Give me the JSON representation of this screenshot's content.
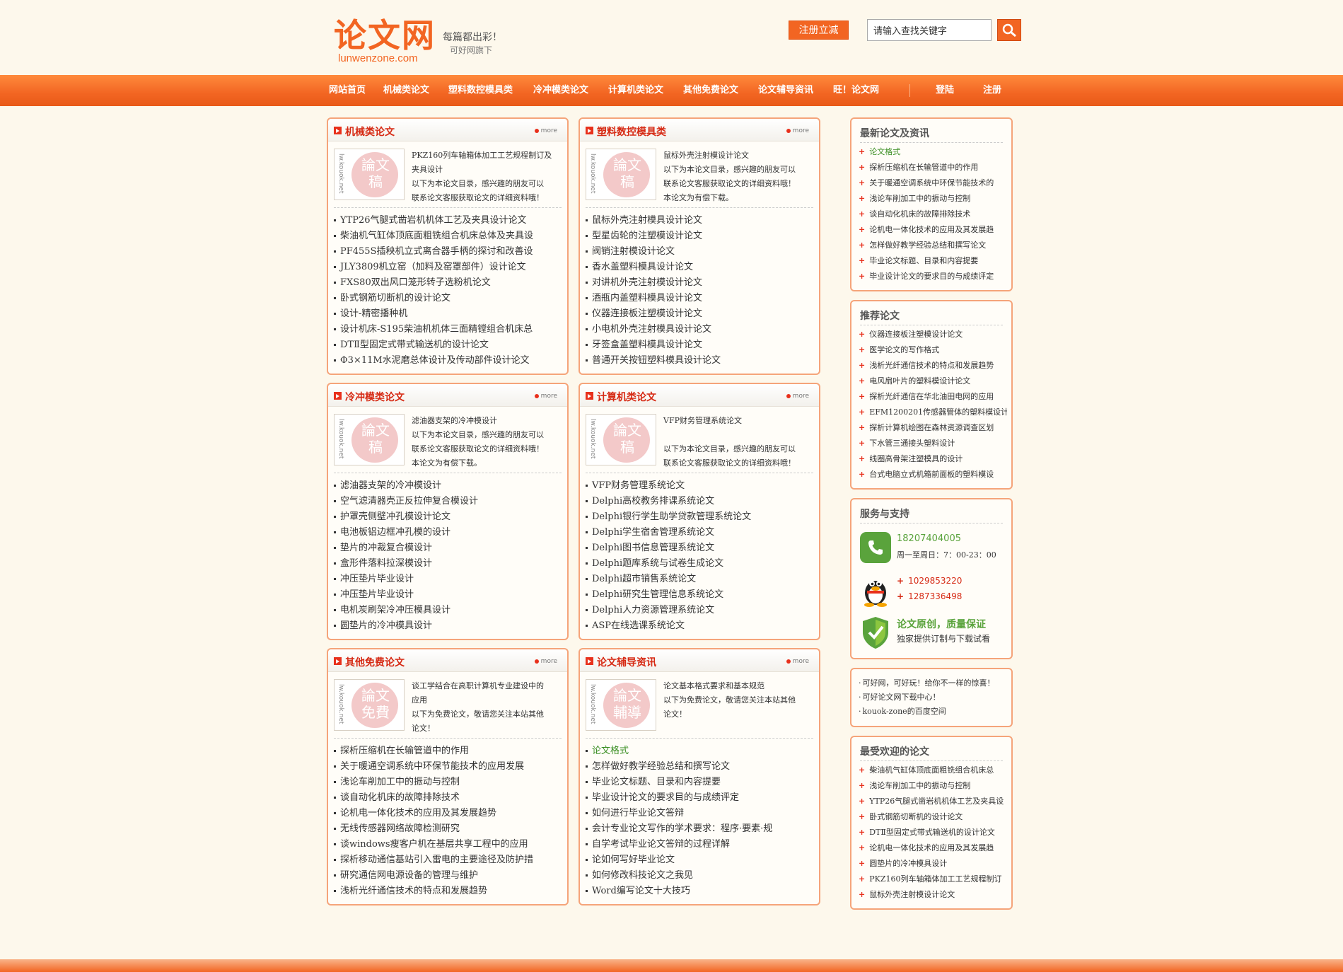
{
  "header": {
    "logo_cn": "论文网",
    "logo_en": "lunwenzone.com",
    "slogan1": "每篇都出彩！",
    "slogan2": "可好网旗下",
    "register_button": "注册立减",
    "search_placeholder": "请输入查找关键字"
  },
  "nav": [
    {
      "label": "网站首页"
    },
    {
      "label": "机械类论文"
    },
    {
      "label": "塑料数控模具类"
    },
    {
      "label": "冷冲模类论文"
    },
    {
      "label": "计算机类论文"
    },
    {
      "label": "其他免费论文"
    },
    {
      "label": "论文辅导资讯"
    },
    {
      "label": "旺！论文网"
    },
    {
      "label": "登陆"
    },
    {
      "label": "注册"
    }
  ],
  "boxes": [
    {
      "title": "机械类论文",
      "more": "more",
      "thumb_v": "lw.kouok.net",
      "thumb_seal": "論文稿",
      "desc": [
        "PKZ160列车轴箱体加工工艺规程制订及",
        "夹具设计",
        "以下为本论文目录，感兴趣的朋友可以",
        "联系论文客服获取论文的详细资料哦！"
      ],
      "items": [
        "YTP26气腿式凿岩机机体工艺及夹具设计论文",
        "柴油机气缸体顶底面粗铣组合机床总体及夹具设",
        "PF455S插秧机立式离合器手柄的探讨和改善设",
        "JLY3809机立窑（加料及窑罩部件）设计论文",
        "FXS80双出风口笼形转子选粉机论文",
        "卧式钢筋切断机的设计论文",
        "设计-精密播种机",
        "设计机床-S195柴油机机体三面精镗组合机床总",
        "DTⅡ型固定式带式输送机的设计论文",
        "Φ3×11M水泥磨总体设计及传动部件设计论文"
      ]
    },
    {
      "title": "塑料数控模具类",
      "more": "more",
      "thumb_v": "lw.kouok.net",
      "thumb_seal": "論文稿",
      "desc": [
        "鼠标外壳注射模设计论文",
        "以下为本论文目录，感兴趣的朋友可以",
        "联系论文客服获取论文的详细资料哦！",
        "本论文为有偿下载。"
      ],
      "items": [
        "鼠标外壳注射模具设计论文",
        "型星齿轮的注塑模设计论文",
        "阀销注射模设计论文",
        "香水盖塑料模具设计论文",
        "对讲机外壳注射模设计论文",
        "酒瓶内盖塑料模具设计论文",
        "仪器连接板注塑模设计论文",
        "小电机外壳注射模具设计论文",
        "牙签盒盖塑料模具设计论文",
        "普通开关按钮塑料模具设计论文"
      ]
    },
    {
      "title": "冷冲模类论文",
      "more": "more",
      "thumb_v": "lw.kouok.net",
      "thumb_seal": "論文稿",
      "desc": [
        "滤油器支架的冷冲模设计",
        "以下为本论文目录，感兴趣的朋友可以",
        "联系论文客服获取论文的详细资料哦！",
        "本论文为有偿下载。"
      ],
      "items": [
        "滤油器支架的冷冲模设计",
        "空气滤清器壳正反拉伸复合模设计",
        "护罩壳侧壁冲孔模设计论文",
        "电池板铝边框冲孔模的设计",
        "垫片的冲裁复合模设计",
        "盒形件落料拉深模设计",
        "冲压垫片毕业设计",
        "冲压垫片毕业设计",
        "电机炭刷架冷冲压模具设计",
        "圆垫片的冷冲模具设计"
      ]
    },
    {
      "title": "计算机类论文",
      "more": "more",
      "thumb_v": "lw.kouok.net",
      "thumb_seal": "論文稿",
      "desc": [
        "VFP财务管理系统论文",
        "",
        "以下为本论文目录，感兴趣的朋友可以",
        "联系论文客服获取论文的详细资料哦！"
      ],
      "items": [
        "VFP财务管理系统论文",
        "Delphi高校教务排课系统论文",
        "Delphi银行学生助学贷款管理系统论文",
        "Delphi学生宿舍管理系统论文",
        "Delphi图书信息管理系统论文",
        "Delphi题库系统与试卷生成论文",
        "Delphi超市销售系统论文",
        "Delphi研究生管理信息系统论文",
        "Delphi人力资源管理系统论文",
        "ASP在线选课系统论文"
      ]
    },
    {
      "title": "其他免费论文",
      "more": "more",
      "thumb_v": "lw.kouok.net",
      "thumb_seal": "論文免費",
      "desc": [
        "谈工学结合在高职计算机专业建设中的",
        "应用",
        "以下为免费论文，敬请您关注本站其他",
        "论文！"
      ],
      "items": [
        "探析压缩机在长输管道中的作用",
        "关于暖通空调系统中环保节能技术的应用发展",
        "浅论车削加工中的振动与控制",
        "谈自动化机床的故障排除技术",
        "论机电一体化技术的应用及其发展趋势",
        "无线传感器网络故障检测研究",
        "谈windows瘦客户机在基层共享工程中的应用",
        "探析移动通信基站引入雷电的主要途径及防护措",
        "研究通信网电源设备的管理与维护",
        "浅析光纤通信技术的特点和发展趋势"
      ]
    },
    {
      "title": "论文辅导资讯",
      "more": "more",
      "thumb_v": "lw.kouok.net",
      "thumb_seal": "論文輔導",
      "desc": [
        "论文基本格式要求和基本规范",
        "以下为免费论文，敬请您关注本站其他",
        "论文！",
        ""
      ],
      "items": [
        "论文格式",
        "怎样做好教学经验总结和撰写论文",
        "毕业论文标题、目录和内容提要",
        "毕业设计论文的要求目的与成绩评定",
        "如何进行毕业论文答辩",
        "会计专业论文写作的学术要求：程序·要素·规",
        "自学考试毕业论文答辩的过程详解",
        "论如何写好毕业论文",
        "如何修改科技论文之我见",
        "Word编写论文十大技巧"
      ]
    }
  ],
  "sidebar": {
    "latest": {
      "title": "最新论文及资讯",
      "items": [
        "论文格式",
        "探析压缩机在长输管道中的作用",
        "关于暖通空调系统中环保节能技术的",
        "浅论车削加工中的振动与控制",
        "谈自动化机床的故障排除技术",
        "论机电一体化技术的应用及其发展趋",
        "怎样做好教学经验总结和撰写论文",
        "毕业论文标题、目录和内容提要",
        "毕业设计论文的要求目的与成绩评定"
      ]
    },
    "recommended": {
      "title": "推荐论文",
      "items": [
        "仪器连接板注塑模设计论文",
        "医学论文的写作格式",
        "浅析光纤通信技术的特点和发展趋势",
        "电风扇叶片的塑料模设计论文",
        "探析光纤通信在华北油田电网的应用",
        "EFM1200201传感器管体的塑料模设计",
        "探析计算机绘图在森林资源调查区划",
        "下水管三通接头塑料设计",
        "线圈高骨架注塑模具的设计",
        "台式电脑立式机箱前面板的塑料模设"
      ]
    },
    "service": {
      "title": "服务与支持",
      "phone": "18207404005",
      "hours": "周一至周日：7：00-23：00",
      "qq1": "1029853220",
      "qq2": "1287336498",
      "guarantee_title": "论文原创，质量保证",
      "guarantee_sub": "独家提供订制与下载试看"
    },
    "links": [
      "可好网，可好玩！给你不一样的惊喜！",
      "可好论文网下载中心！",
      "kouok-zone的百度空间"
    ],
    "popular": {
      "title": "最受欢迎的论文",
      "items": [
        "柴油机气缸体顶底面粗铣组合机床总",
        "浅论车削加工中的振动与控制",
        "YTP26气腿式凿岩机机体工艺及夹具设",
        "卧式钢筋切断机的设计论文",
        "DTⅡ型固定式带式输送机的设计论文",
        "论机电一体化技术的应用及其发展趋",
        "圆垫片的冷冲模具设计",
        "PKZ160列车轴箱体加工工艺规程制订",
        "鼠标外壳注射模设计论文"
      ]
    }
  }
}
